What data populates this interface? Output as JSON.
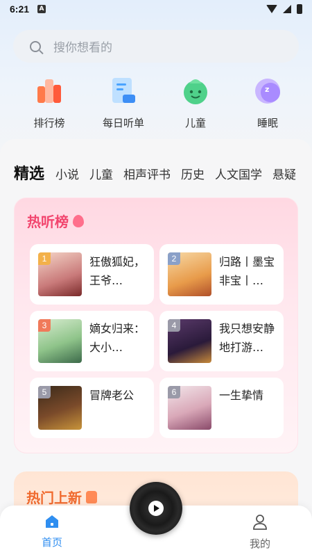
{
  "status_bar": {
    "time": "6:21",
    "notification_badge": "A"
  },
  "search": {
    "placeholder": "搜你想看的"
  },
  "quick_menu": [
    {
      "label": "排行榜",
      "icon": "ranking-bars-icon"
    },
    {
      "label": "每日听单",
      "icon": "daily-list-icon"
    },
    {
      "label": "儿童",
      "icon": "children-face-icon"
    },
    {
      "label": "睡眠",
      "icon": "sleep-moon-icon"
    }
  ],
  "tabs": [
    "精选",
    "小说",
    "儿童",
    "相声评书",
    "历史",
    "人文国学",
    "悬疑"
  ],
  "hot_list": {
    "title": "热听榜",
    "books": [
      {
        "rank": "1",
        "title": "狂傲狐妃，王爷…"
      },
      {
        "rank": "2",
        "title": "归路丨墨宝非宝丨…"
      },
      {
        "rank": "3",
        "title": "嫡女归来：大小…"
      },
      {
        "rank": "4",
        "title": "我只想安静地打游…"
      },
      {
        "rank": "5",
        "title": "冒牌老公"
      },
      {
        "rank": "6",
        "title": "一生挚情"
      }
    ]
  },
  "new_section": {
    "title": "热门上新"
  },
  "bottom_nav": {
    "home": "首页",
    "mine": "我的"
  },
  "colors": {
    "accent_blue": "#2f8ef0",
    "hot_red": "#f2456e",
    "new_orange": "#f06a2e"
  }
}
